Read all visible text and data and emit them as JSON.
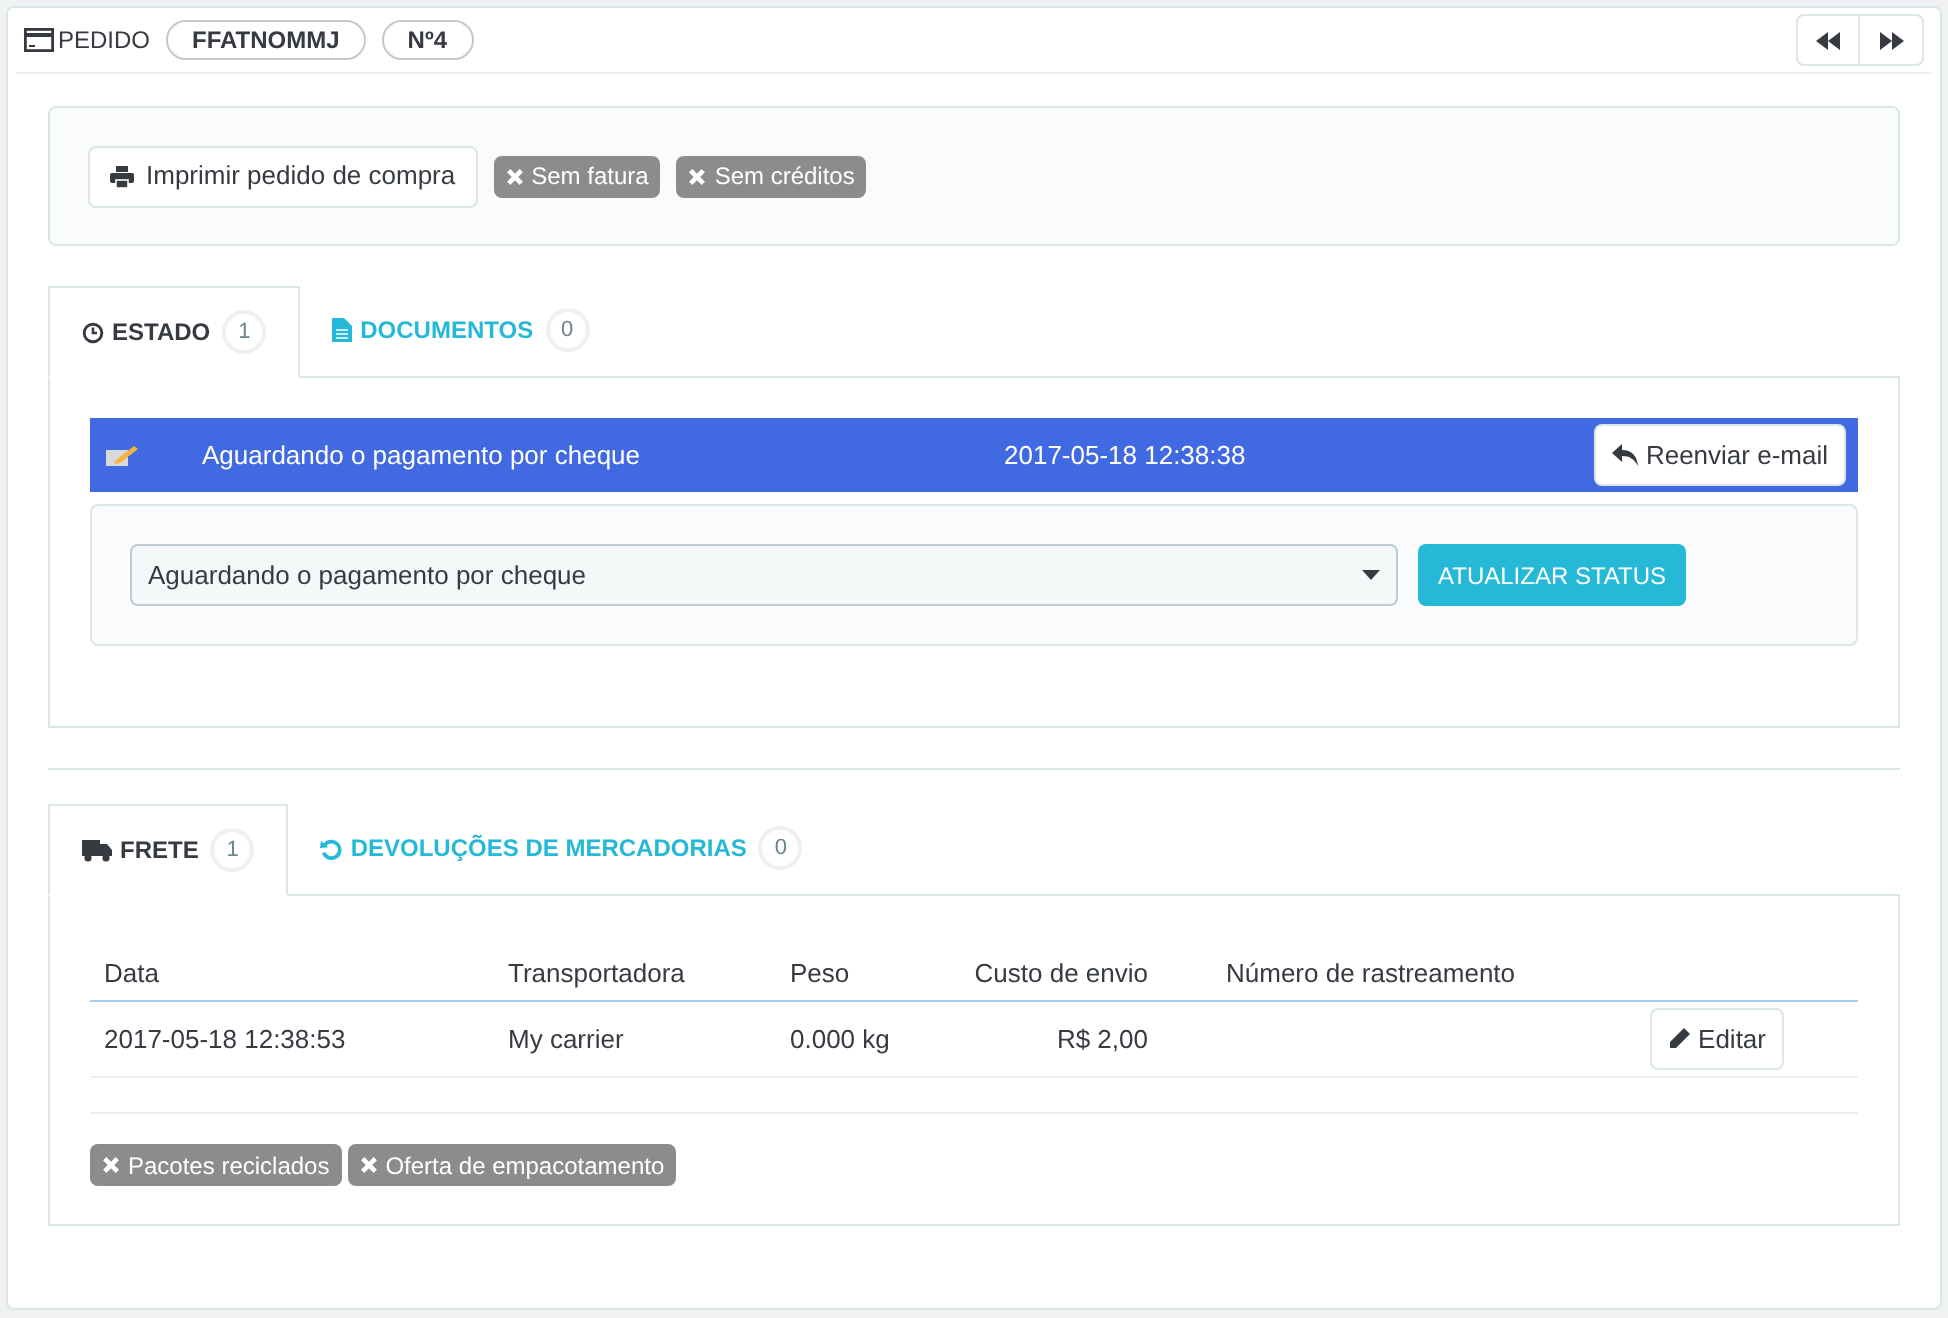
{
  "header": {
    "title": "PEDIDO",
    "reference": "FFATNOMMJ",
    "number": "Nº4"
  },
  "actions": {
    "print_button": "Imprimir pedido de compra",
    "badges": [
      "Sem fatura",
      "Sem créditos"
    ]
  },
  "status_tabs": [
    {
      "label": "ESTADO",
      "count": "1",
      "selected": true
    },
    {
      "label": "DOCUMENTOS",
      "count": "0",
      "selected": false
    }
  ],
  "history": [
    {
      "status": "Aguardando o pagamento por cheque",
      "date": "2017-05-18 12:38:38",
      "button": "Reenviar e-mail",
      "color": "#4169e1"
    }
  ],
  "status_select": {
    "value": "Aguardando o pagamento por cheque",
    "button": "ATUALIZAR STATUS"
  },
  "shipping_tabs": [
    {
      "label": "FRETE",
      "count": "1",
      "selected": true
    },
    {
      "label": "DEVOLUÇÕES DE MERCADORIAS",
      "count": "0",
      "selected": false
    }
  ],
  "table": {
    "columns": [
      "Data",
      "Transportadora",
      "Peso",
      "Custo de envio",
      "Número de rastreamento"
    ],
    "rows": [
      {
        "cells": [
          "2017-05-18 12:38:53",
          "My carrier",
          "0.000 kg",
          "R$ 2,00",
          ""
        ],
        "button": "Editar"
      }
    ]
  },
  "shipping_badges": [
    "Pacotes reciclados",
    "Oferta de empacotamento"
  ]
}
